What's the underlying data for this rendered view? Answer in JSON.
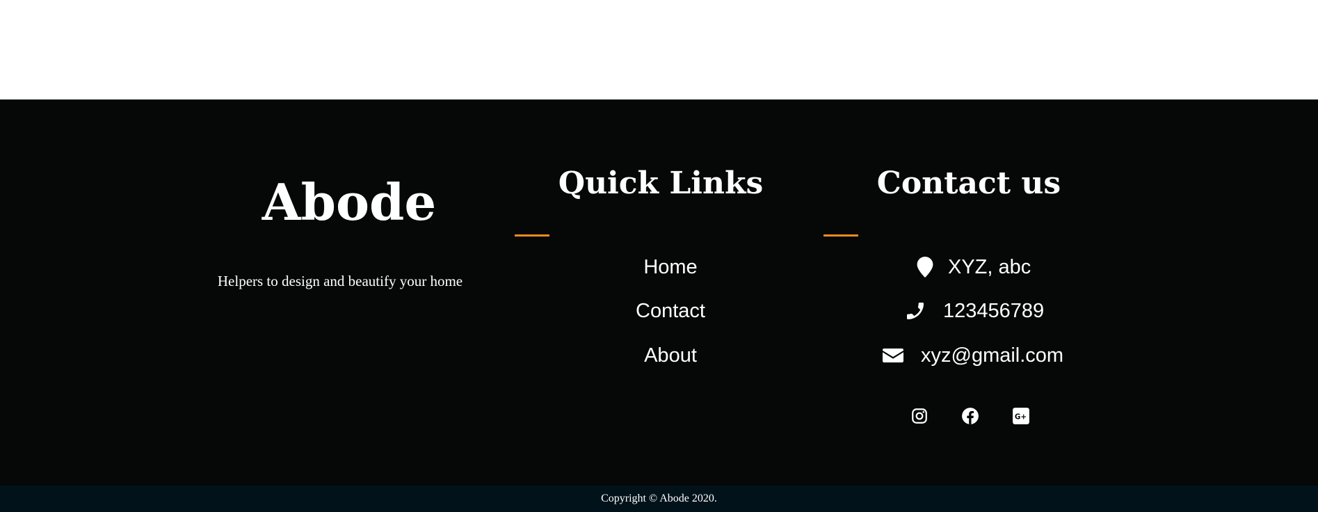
{
  "footer": {
    "brand": {
      "title": "Abode",
      "tagline": "Helpers to design and beautify your home"
    },
    "quick_links": {
      "heading": "Quick Links",
      "links": [
        "Home",
        "Contact",
        "About"
      ]
    },
    "contact": {
      "heading": "Contact us",
      "address": "XYZ, abc",
      "phone": "123456789",
      "email": "xyz@gmail.com"
    },
    "social_icons": [
      "instagram-icon",
      "facebook-icon",
      "google-plus-icon"
    ],
    "accent_color": "#f08c1e",
    "background_color": "#060707"
  },
  "copyright": {
    "text": "Copyright © Abode 2020.",
    "background_color": "#02121a"
  }
}
